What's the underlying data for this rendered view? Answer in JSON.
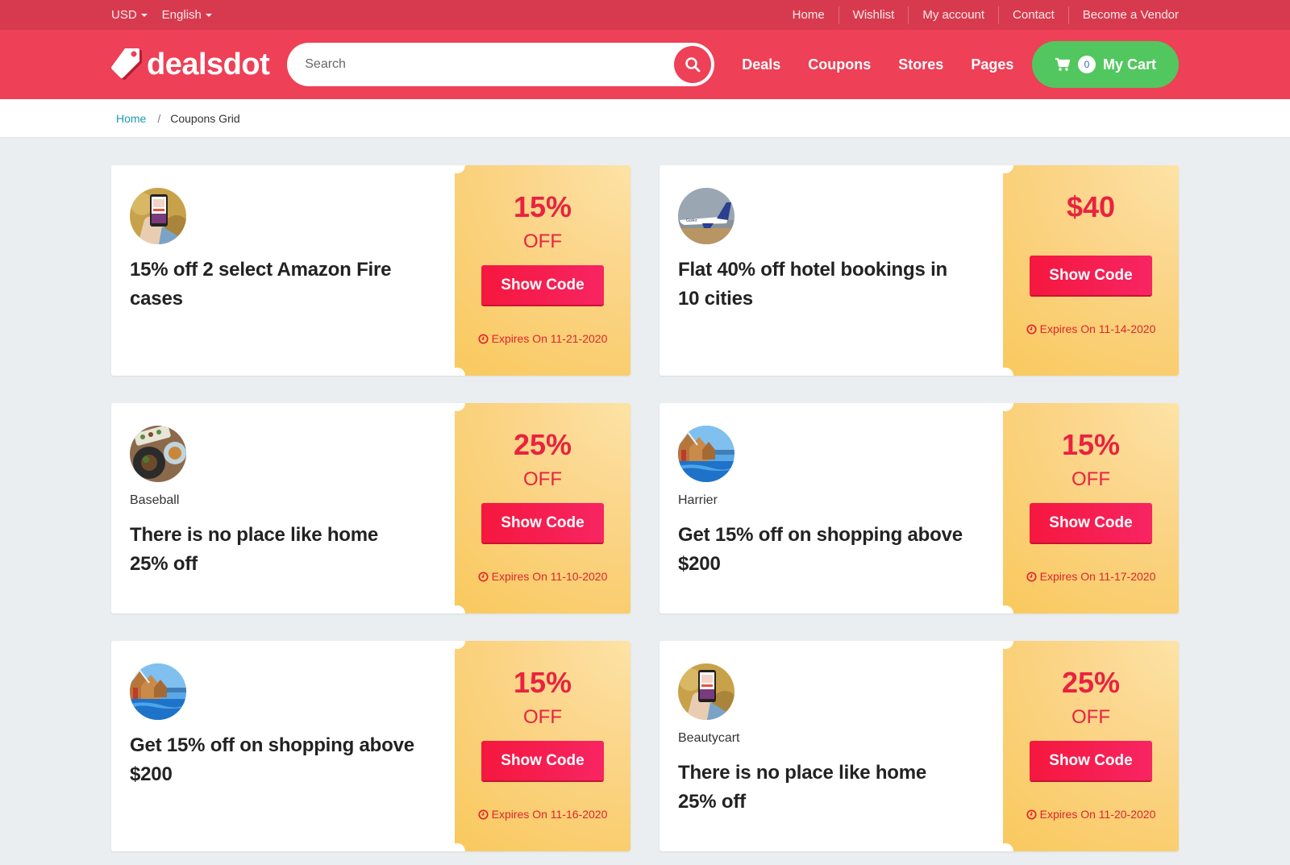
{
  "topbar": {
    "currency": "USD",
    "language": "English",
    "links": [
      "Home",
      "Wishlist",
      "My account",
      "Contact",
      "Become a Vendor"
    ]
  },
  "header": {
    "logo_text": "dealsdot",
    "search_placeholder": "Search",
    "nav": [
      "Deals",
      "Coupons",
      "Stores",
      "Pages"
    ],
    "cart_count": "0",
    "cart_label": "My Cart"
  },
  "breadcrumb": {
    "home": "Home",
    "separator": "/",
    "current": "Coupons Grid"
  },
  "colors": {
    "topbar": "#d73a4f",
    "header": "#ee4056",
    "cart": "#52c75f",
    "accent": "#e8233f",
    "coupon_panel": "#f9c95d"
  },
  "coupons": [
    {
      "image": "phone-promo-image",
      "store": "",
      "title": "15% off 2 select Amazon Fire cases",
      "amount": "15%",
      "off": "OFF",
      "button": "Show Code",
      "expires": "Expires On 11-21-2020"
    },
    {
      "image": "airplane-image",
      "store": "",
      "title": "Flat 40% off hotel bookings in 10 cities",
      "amount": "$40",
      "off": "",
      "button": "Show Code",
      "expires": "Expires On 11-14-2020"
    },
    {
      "image": "food-image",
      "store": "Baseball",
      "title": "There is no place like home 25% off",
      "amount": "25%",
      "off": "OFF",
      "button": "Show Code",
      "expires": "Expires On 11-10-2020"
    },
    {
      "image": "resort-image",
      "store": "Harrier",
      "title": "Get 15% off on shopping above $200",
      "amount": "15%",
      "off": "OFF",
      "button": "Show Code",
      "expires": "Expires On 11-17-2020"
    },
    {
      "image": "resort-image",
      "store": "",
      "title": "Get 15% off on shopping above $200",
      "amount": "15%",
      "off": "OFF",
      "button": "Show Code",
      "expires": "Expires On 11-16-2020"
    },
    {
      "image": "phone-promo-image",
      "store": "Beautycart",
      "title": "There is no place like home 25% off",
      "amount": "25%",
      "off": "OFF",
      "button": "Show Code",
      "expires": "Expires On 11-20-2020"
    }
  ]
}
